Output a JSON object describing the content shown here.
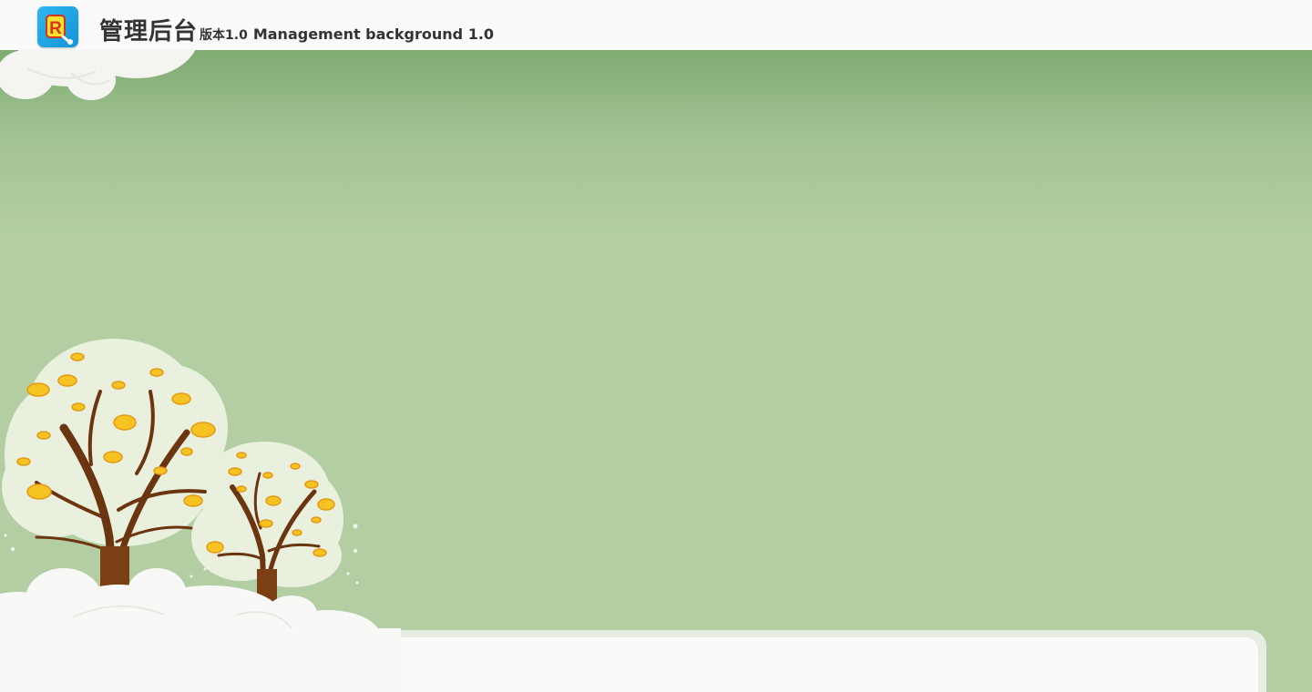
{
  "header": {
    "logo_icon": "app-logo-icon",
    "title": "管理后台",
    "version_label": "版本1.0",
    "subtitle": "Management background 1.0"
  },
  "colors": {
    "header_bg": "#fafafa",
    "background_top": "#7fab71",
    "background_main": "#b3cea3",
    "panel_bg": "#fafafa",
    "text": "#333333",
    "logo_bg": "#1ea6e6"
  },
  "decor": {
    "top_clouds": "cloud-cluster-top-left",
    "trees": "money-trees-illustration",
    "bottom_clouds": "cloud-cluster-bottom-left"
  }
}
